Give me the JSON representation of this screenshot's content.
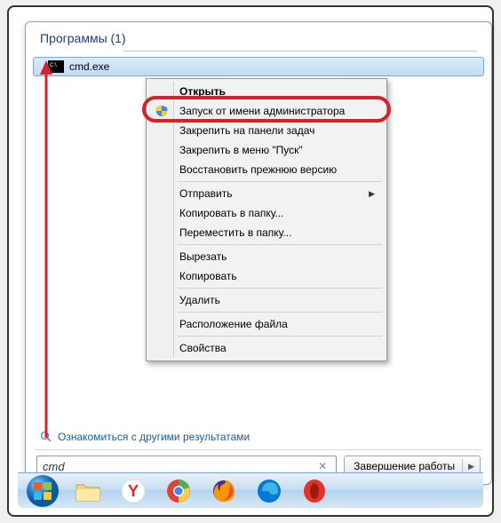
{
  "section": {
    "title": "Программы (1)"
  },
  "result": {
    "name": "cmd.exe"
  },
  "more_results": {
    "label": "Ознакомиться с другими результатами"
  },
  "search": {
    "value": "cmd"
  },
  "shutdown": {
    "label": "Завершение работы"
  },
  "context_menu": {
    "open": "Открыть",
    "run_admin": "Запуск от имени администратора",
    "pin_taskbar": "Закрепить на панели задач",
    "pin_start": "Закрепить в меню \"Пуск\"",
    "restore": "Восстановить прежнюю версию",
    "send_to": "Отправить",
    "copy_to": "Копировать в папку...",
    "move_to": "Переместить в папку...",
    "cut": "Вырезать",
    "copy": "Копировать",
    "delete": "Удалить",
    "location": "Расположение файла",
    "properties": "Свойства"
  }
}
